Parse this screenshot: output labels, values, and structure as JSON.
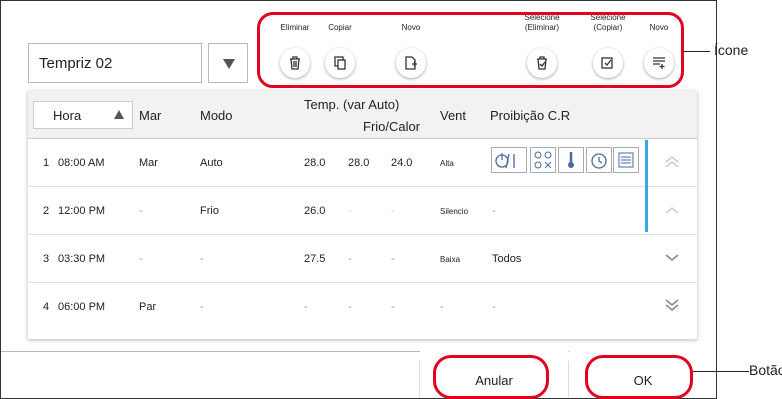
{
  "schedule_select": {
    "value": "Tempriz 02"
  },
  "toolbar": {
    "delete": "Eliminar",
    "copy": "Copiar",
    "new": "Novo",
    "select_delete": "Selecione\n(Eliminar)",
    "select_copy": "Selecione\n(Copiar)",
    "new_list": "Novo"
  },
  "table": {
    "headers": {
      "hora": "Hora",
      "mar": "Mar",
      "modo": "Modo",
      "temp": "Temp. (var Auto)",
      "temp_sub": "Frio/Calor",
      "vent": "Vent",
      "proib": "Proibição C.R"
    },
    "rows": [
      {
        "num": "1",
        "time": "08:00 AM",
        "mar": "Mar",
        "modo": "Auto",
        "t1": "28.0",
        "t2": "28.0",
        "t3": "24.0",
        "vent": "Alta",
        "proib": ""
      },
      {
        "num": "2",
        "time": "12:00 PM",
        "mar": "-",
        "modo": "Frio",
        "t1": "26.0",
        "t2": "-",
        "t3": "-",
        "vent": "Silencio",
        "proib": "-"
      },
      {
        "num": "3",
        "time": "03:30 PM",
        "mar": "-",
        "modo": "-",
        "t1": "27.5",
        "t2": "-",
        "t3": "-",
        "vent": "Baixa",
        "proib": "Todos"
      },
      {
        "num": "4",
        "time": "06:00 PM",
        "mar": "Par",
        "modo": "-",
        "t1": "-",
        "t2": "-",
        "t3": "-",
        "vent": "-",
        "proib": "-"
      }
    ]
  },
  "buttons": {
    "cancel": "Anular",
    "ok": "OK"
  },
  "callouts": {
    "icone": "Ícone",
    "botao": "Botão"
  },
  "colors": {
    "highlight": "#e4001e",
    "scrollbar": "#3aa8e0",
    "header_bg": "#f2f2f2"
  }
}
